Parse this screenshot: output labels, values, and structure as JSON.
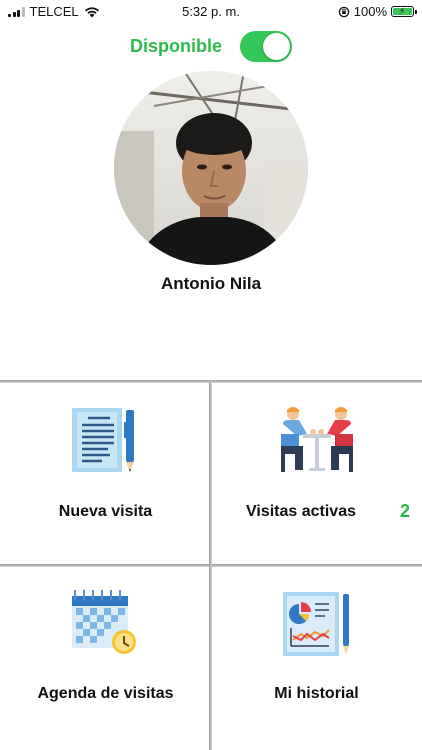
{
  "status_bar": {
    "carrier": "TELCEL",
    "time": "5:32 p. m.",
    "battery": "100%"
  },
  "availability": {
    "label": "Disponible",
    "enabled": true
  },
  "profile": {
    "name": "Antonio Nila"
  },
  "menu": {
    "nueva_visita": {
      "label": "Nueva visita",
      "icon": "document-pen-icon"
    },
    "visitas_activas": {
      "label": "Visitas activas",
      "count": "2",
      "icon": "meeting-icon"
    },
    "agenda": {
      "label": "Agenda de visitas",
      "icon": "calendar-clock-icon"
    },
    "historial": {
      "label": "Mi historial",
      "icon": "report-chart-icon"
    }
  },
  "colors": {
    "accent_green": "#2dbb4d",
    "toggle_on": "#34c759"
  }
}
